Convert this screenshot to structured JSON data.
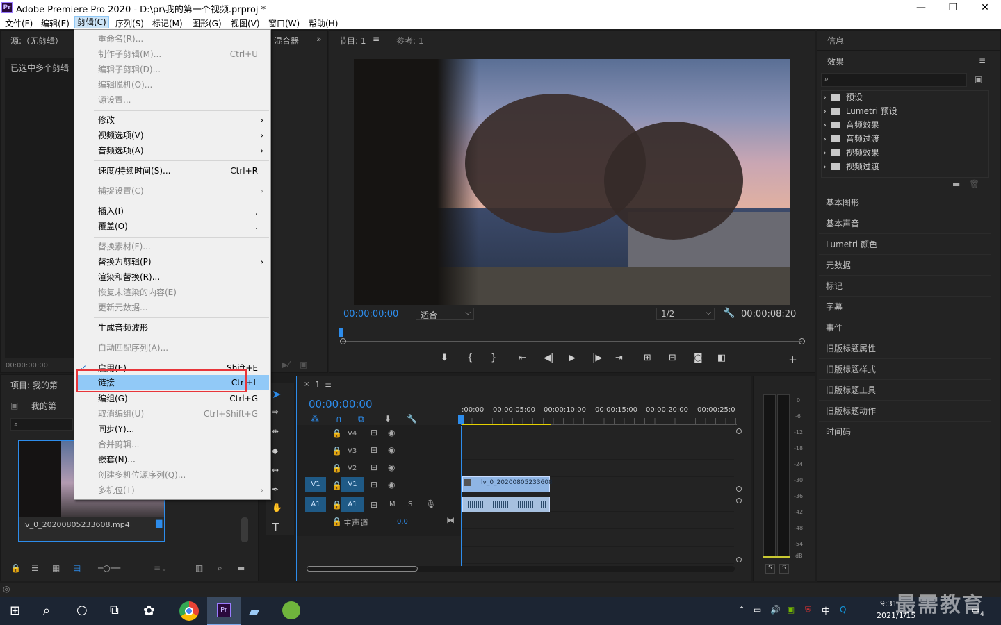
{
  "window": {
    "title": "Adobe Premiere Pro 2020 - D:\\pr\\我的第一个视频.prproj *",
    "minimize": "—",
    "maximize": "❐",
    "close": "✕"
  },
  "menubar": [
    "文件(F)",
    "编辑(E)",
    "剪辑(C)",
    "序列(S)",
    "标记(M)",
    "图形(G)",
    "视图(V)",
    "窗口(W)",
    "帮助(H)"
  ],
  "source": {
    "title": "源:（无剪辑）",
    "mixer": "混合器",
    "message": "已选中多个剪辑",
    "timecode": "00:00:00:00"
  },
  "program": {
    "tab": "节目: 1",
    "ref": "参考: 1",
    "tc_in": "00:00:00:00",
    "fit": "适合",
    "res": "1/2",
    "tc_out": "00:00:08:20"
  },
  "clip_menu": {
    "items": [
      {
        "label": "重命名(R)...",
        "enabled": false
      },
      {
        "label": "制作子剪辑(M)...",
        "shortcut": "Ctrl+U",
        "enabled": false
      },
      {
        "label": "编辑子剪辑(D)...",
        "enabled": false
      },
      {
        "label": "编辑脱机(O)...",
        "enabled": false
      },
      {
        "label": "源设置...",
        "enabled": false
      },
      {
        "label": "修改",
        "enabled": true,
        "submenu": true
      },
      {
        "label": "视频选项(V)",
        "enabled": true,
        "submenu": true
      },
      {
        "label": "音频选项(A)",
        "enabled": true,
        "submenu": true
      },
      {
        "label": "速度/持续时间(S)...",
        "shortcut": "Ctrl+R",
        "enabled": true
      },
      {
        "label": "捕捉设置(C)",
        "enabled": false,
        "submenu": true
      },
      {
        "label": "插入(I)",
        "shortcut": ",",
        "enabled": true
      },
      {
        "label": "覆盖(O)",
        "shortcut": ".",
        "enabled": true
      },
      {
        "label": "替换素材(F)...",
        "enabled": false
      },
      {
        "label": "替换为剪辑(P)",
        "enabled": true,
        "submenu": true
      },
      {
        "label": "渲染和替换(R)...",
        "enabled": true
      },
      {
        "label": "恢复未渲染的内容(E)",
        "enabled": false
      },
      {
        "label": "更新元数据...",
        "enabled": false
      },
      {
        "label": "生成音频波形",
        "enabled": true
      },
      {
        "label": "自动匹配序列(A)...",
        "enabled": false
      },
      {
        "label": "启用(E)",
        "shortcut": "Shift+E",
        "enabled": true,
        "checked": true
      },
      {
        "label": "链接",
        "shortcut": "Ctrl+L",
        "enabled": true,
        "highlighted": true
      },
      {
        "label": "编组(G)",
        "shortcut": "Ctrl+G",
        "enabled": true
      },
      {
        "label": "取消编组(U)",
        "shortcut": "Ctrl+Shift+G",
        "enabled": false
      },
      {
        "label": "同步(Y)...",
        "enabled": true
      },
      {
        "label": "合并剪辑...",
        "enabled": false
      },
      {
        "label": "嵌套(N)...",
        "enabled": true
      },
      {
        "label": "创建多机位源序列(Q)...",
        "enabled": false
      },
      {
        "label": "多机位(T)",
        "enabled": false,
        "submenu": true
      }
    ]
  },
  "project": {
    "tab": "项目: 我的第一",
    "bin": "我的第一",
    "clip_name": "lv_0_20200805233608.mp4"
  },
  "timeline": {
    "tab": "1",
    "timecode": "00:00:00:00",
    "ruler": [
      ":00:00",
      "00:00:05:00",
      "00:00:10:00",
      "00:00:15:00",
      "00:00:20:00",
      "00:00:25:0"
    ],
    "tracks": [
      "V4",
      "V3",
      "V2",
      "V1",
      "A1"
    ],
    "master": "主声道",
    "master_val": "0.0",
    "clip": "lv_0_20200805233608"
  },
  "meter": {
    "scale": [
      "0",
      "-6",
      "-12",
      "-18",
      "-24",
      "-30",
      "-36",
      "-42",
      "-48",
      "-54",
      "dB"
    ],
    "solo": [
      "S",
      "S"
    ]
  },
  "right": {
    "info": "信息",
    "effects": "效果",
    "tree": [
      "预设",
      "Lumetri 预设",
      "音频效果",
      "音频过渡",
      "视频效果",
      "视频过渡"
    ],
    "panels": [
      "基本图形",
      "基本声音",
      "Lumetri 颜色",
      "元数据",
      "标记",
      "字幕",
      "事件",
      "旧版标题属性",
      "旧版标题样式",
      "旧版标题工具",
      "旧版标题动作",
      "时间码"
    ]
  },
  "taskbar": {
    "time": "9:31",
    "date": "2021/1/15",
    "ime": "中",
    "notif": "4",
    "watermark": "最需教育"
  }
}
